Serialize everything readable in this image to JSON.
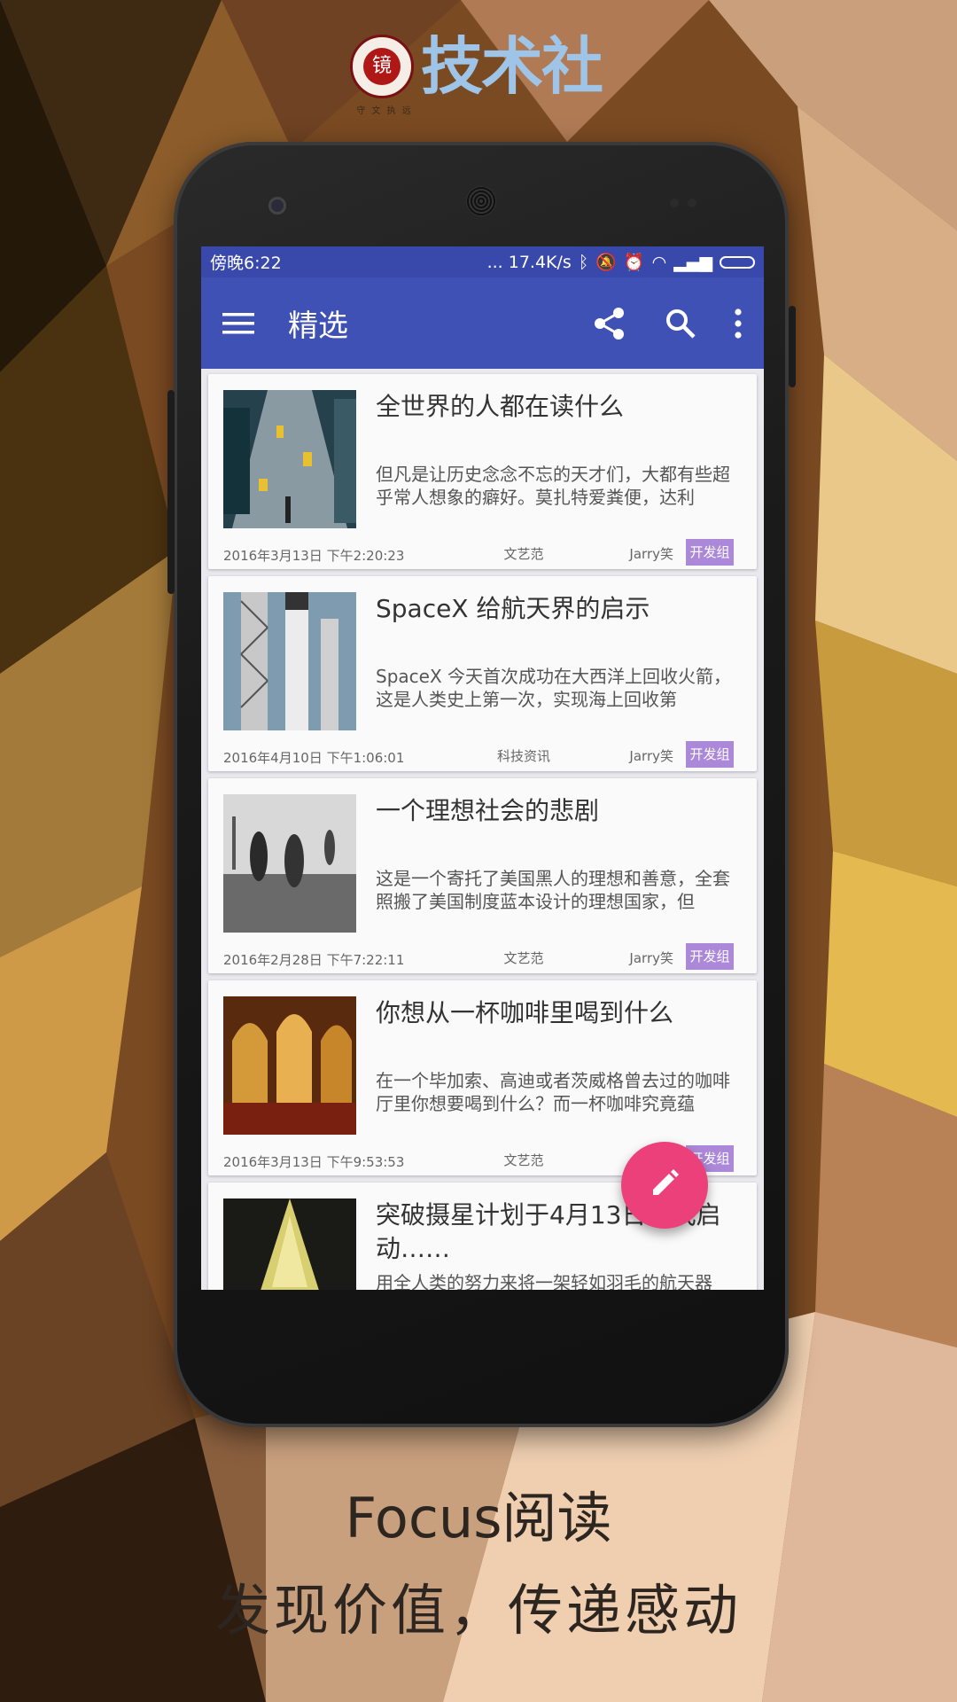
{
  "brand": {
    "name": "技术社",
    "seal_char": "镜",
    "seal_caption": "守 文 执 远"
  },
  "status_bar": {
    "time": "傍晚6:22",
    "speed": "... 17.4K/s"
  },
  "toolbar": {
    "title": "精选"
  },
  "articles": [
    {
      "title": "全世界的人都在读什么",
      "summary": "但凡是让历史念念不忘的天才们，大都有些超乎常人想象的癖好。莫扎特爱粪便，达利",
      "date": "2016年3月13日 下午2:20:23",
      "category": "文艺范",
      "author": "Jarry笑",
      "badge": "开发组"
    },
    {
      "title": "SpaceX 给航天界的启示",
      "summary": "SpaceX 今天首次成功在大西洋上回收火箭，这是人类史上第一次，实现海上回收第",
      "date": "2016年4月10日 下午1:06:01",
      "category": "科技资讯",
      "author": "Jarry笑",
      "badge": "开发组"
    },
    {
      "title": "一个理想社会的悲剧",
      "summary": "这是一个寄托了美国黑人的理想和善意，全套照搬了美国制度蓝本设计的理想国家，但",
      "date": "2016年2月28日 下午7:22:11",
      "category": "文艺范",
      "author": "Jarry笑",
      "badge": "开发组"
    },
    {
      "title": "你想从一杯咖啡里喝到什么",
      "summary": "在一个毕加索、高迪或者茨威格曾去过的咖啡厅里你想要喝到什么？而一杯咖啡究竟蕴",
      "date": "2016年3月13日 下午9:53:53",
      "category": "文艺范",
      "author": "",
      "badge": "开发组"
    },
    {
      "title": "突破摄星计划于4月13日正式启动……",
      "summary": "用全人类的努力来将一架轻如羽毛的航天器",
      "date": "",
      "category": "",
      "author": "",
      "badge": ""
    }
  ],
  "slogan": {
    "line1": "Focus阅读",
    "line2": "发现价值，传递感动"
  },
  "colors": {
    "primary": "#3f51b5",
    "status": "#3949ab",
    "accent": "#ec407a",
    "badge": "#ab88d8"
  }
}
